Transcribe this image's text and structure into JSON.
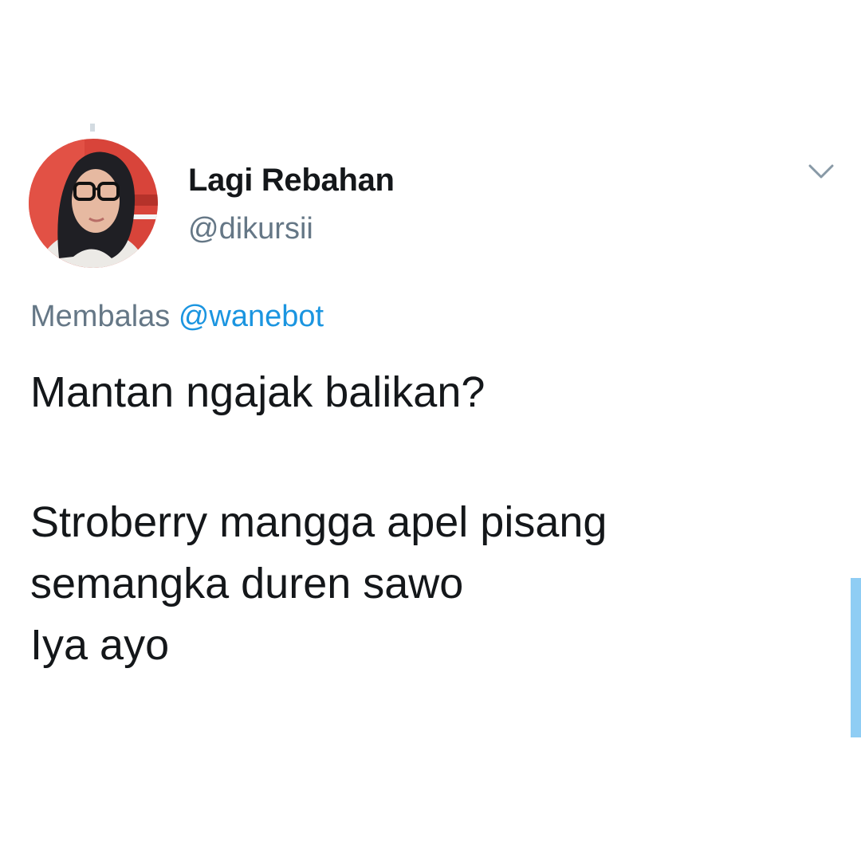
{
  "user": {
    "display_name": "Lagi Rebahan",
    "handle": "@dikursii",
    "avatar_icon": "profile-avatar"
  },
  "reply": {
    "prefix": "Membalas",
    "mention": "@wanebot"
  },
  "tweet": {
    "line1": "Mantan ngajak balikan?",
    "line2": "Stroberry mangga apel pisang",
    "line3": "semangka duren sawo",
    "line4": "Iya ayo"
  },
  "icons": {
    "more_menu": "chevron-down-icon"
  },
  "colors": {
    "text": "#14171a",
    "muted": "#657786",
    "link": "#1b95e0",
    "scrollbar": "#8fcdf4"
  }
}
